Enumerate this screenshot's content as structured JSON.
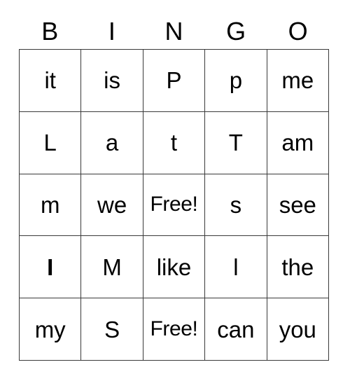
{
  "card": {
    "title": "BINGO",
    "header": {
      "letters": [
        "B",
        "I",
        "N",
        "G",
        "O"
      ]
    },
    "grid": {
      "columns": 5,
      "rows": 5,
      "border_color": "#3a3a3a",
      "background_color": "#ffffff",
      "text_color": "#000000",
      "free_label": "Free!",
      "cells": [
        [
          {
            "text": "it",
            "style": "normal"
          },
          {
            "text": "is",
            "style": "normal"
          },
          {
            "text": "P",
            "style": "normal"
          },
          {
            "text": "p",
            "style": "normal"
          },
          {
            "text": "me",
            "style": "normal"
          }
        ],
        [
          {
            "text": "L",
            "style": "normal"
          },
          {
            "text": "a",
            "style": "normal"
          },
          {
            "text": "t",
            "style": "normal"
          },
          {
            "text": "T",
            "style": "normal"
          },
          {
            "text": "am",
            "style": "normal"
          }
        ],
        [
          {
            "text": "m",
            "style": "normal"
          },
          {
            "text": "we",
            "style": "normal"
          },
          {
            "text": "Free!",
            "style": "free"
          },
          {
            "text": "s",
            "style": "normal"
          },
          {
            "text": "see",
            "style": "normal"
          }
        ],
        [
          {
            "text": "I",
            "style": "bold"
          },
          {
            "text": "M",
            "style": "normal"
          },
          {
            "text": "like",
            "style": "normal"
          },
          {
            "text": "l",
            "style": "normal"
          },
          {
            "text": "the",
            "style": "normal"
          }
        ],
        [
          {
            "text": "my",
            "style": "normal"
          },
          {
            "text": "S",
            "style": "normal"
          },
          {
            "text": "Free!",
            "style": "free"
          },
          {
            "text": "can",
            "style": "normal"
          },
          {
            "text": "you",
            "style": "normal"
          }
        ]
      ]
    }
  }
}
